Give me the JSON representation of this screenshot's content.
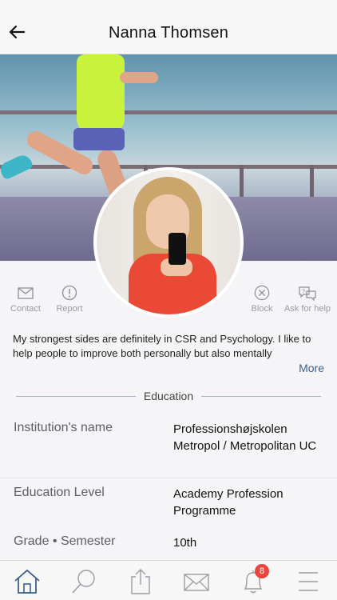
{
  "header": {
    "title": "Nanna Thomsen",
    "back_icon": "arrow-left-icon"
  },
  "actions": {
    "contact": "Contact",
    "report": "Report",
    "block": "Block",
    "ask_for_help": "Ask for help"
  },
  "bio": {
    "text": "My strongest sides are definitely in CSR and Psychology. I like to help people to improve both personally but also mentally",
    "more_label": "More"
  },
  "education": {
    "section_title": "Education",
    "rows": [
      {
        "label": "Institution's name",
        "value": "Professionshøjskolen Metropol / Metropolitan UC"
      },
      {
        "label": "Education Level",
        "value": "Academy Profession Programme"
      },
      {
        "label": "Grade • Semester",
        "value": "10th"
      }
    ]
  },
  "tabbar": {
    "notification_count": "8",
    "accent_color": "#3b5f89",
    "icons": [
      "home-icon",
      "search-icon",
      "share-icon",
      "mail-icon",
      "bell-icon",
      "menu-icon"
    ]
  }
}
